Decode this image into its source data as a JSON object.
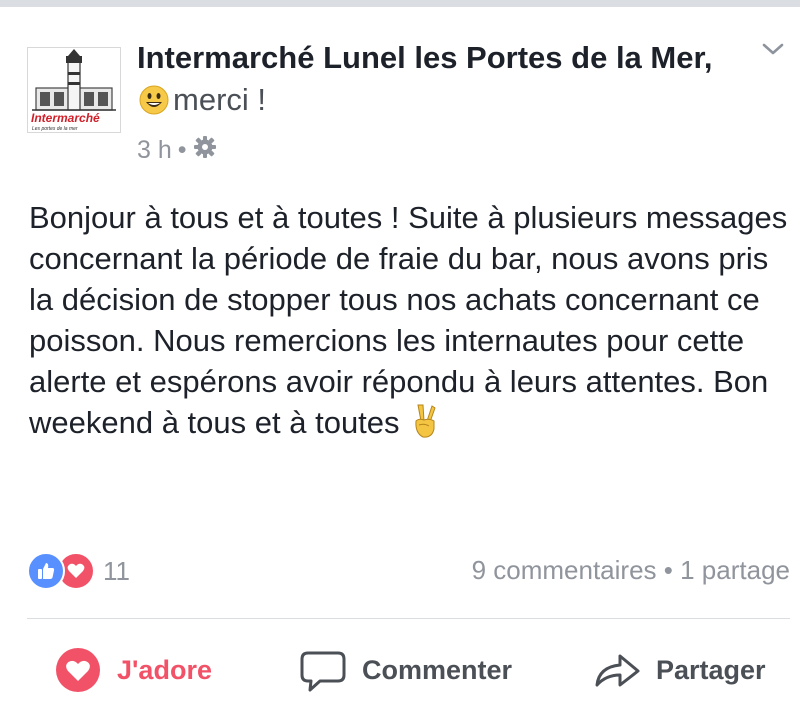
{
  "post": {
    "page_name": "Intermarché Lunel les Portes de la Mer,",
    "title_suffix": "merci !",
    "emoji_icon": "smiling-face-icon",
    "time": "3 h",
    "dot": "•",
    "privacy_icon": "gear-icon",
    "avatar_brand": "Intermarché",
    "avatar_tagline": "Les portes de la mer",
    "text": "Bonjour à tous et à toutes ! Suite à plusieurs messages concernant la période de fraie du bar, nous avons pris la décision de stopper tous nos achats concernant ce poisson. Nous remercions les internautes pour cette alerte et espérons avoir répondu à leurs attentes. Bon weekend à tous et à toutes",
    "text_emoji": "victory-hand-icon"
  },
  "reactions": {
    "count": "11",
    "icons": [
      "like-icon",
      "love-icon"
    ]
  },
  "stats": {
    "comments": "9 commentaires",
    "separator": "•",
    "shares": "1 partage"
  },
  "actions": {
    "love_label": "J'adore",
    "comment_label": "Commenter",
    "share_label": "Partager"
  },
  "colors": {
    "love": "#f25268",
    "like": "#5890ff",
    "text": "#1d2129",
    "muted": "#90949c"
  }
}
